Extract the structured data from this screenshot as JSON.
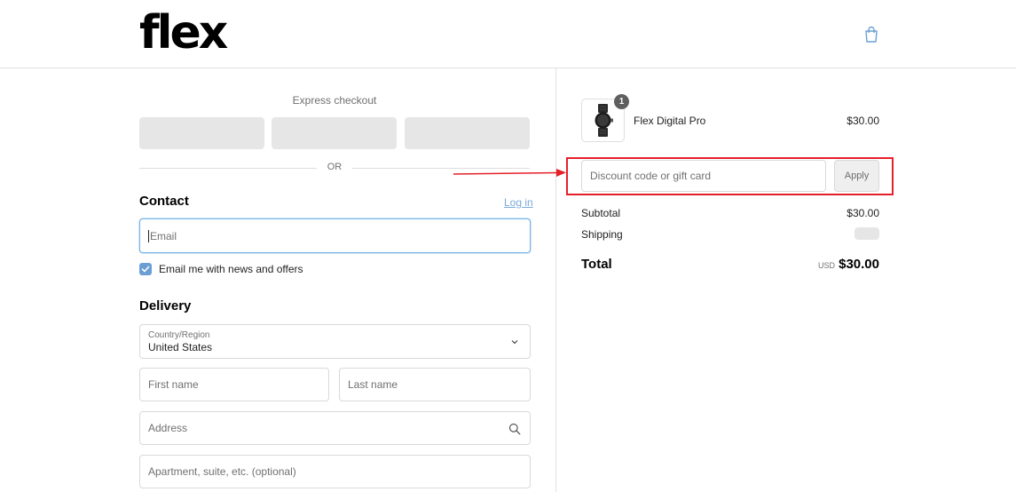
{
  "header": {
    "logo_text": "flex",
    "cart_icon": "shopping-bag-icon"
  },
  "express_checkout": {
    "label": "Express checkout",
    "or_text": "OR"
  },
  "contact": {
    "title": "Contact",
    "login_label": "Log in",
    "email_placeholder": "Email",
    "newsletter_label": "Email me with news and offers",
    "newsletter_checked": true
  },
  "delivery": {
    "title": "Delivery",
    "country_label": "Country/Region",
    "country_value": "United States",
    "first_name_placeholder": "First name",
    "last_name_placeholder": "Last name",
    "address_placeholder": "Address",
    "apartment_placeholder": "Apartment, suite, etc. (optional)"
  },
  "order": {
    "item": {
      "name": "Flex Digital Pro",
      "price": "$30.00",
      "quantity": "1"
    },
    "discount_placeholder": "Discount code or gift card",
    "apply_label": "Apply",
    "subtotal_label": "Subtotal",
    "subtotal_value": "$30.00",
    "shipping_label": "Shipping",
    "total_label": "Total",
    "total_currency": "USD",
    "total_value": "$30.00"
  },
  "colors": {
    "accent": "#7aa9dc",
    "highlight": "#e5202a",
    "checkbox": "#6b9fd4"
  }
}
